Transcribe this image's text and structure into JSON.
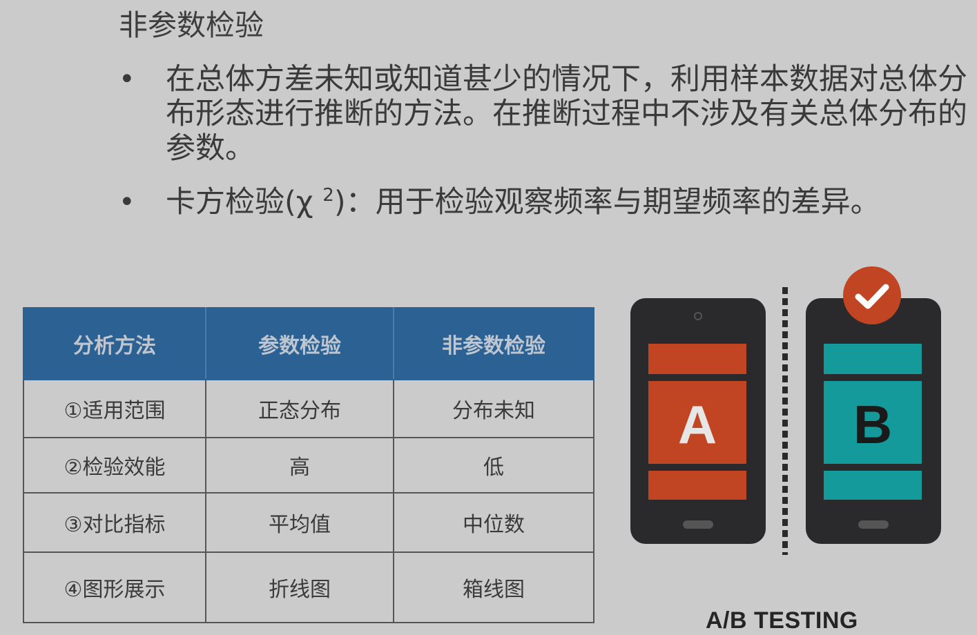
{
  "title": "非参数检验",
  "bullets": [
    {
      "marker": "•",
      "text": "在总体方差未知或知道甚少的情况下，利用样本数据对总体分布形态进行推断的方法。在推断过程中不涉及有关总体分布的参数。"
    },
    {
      "marker": "•",
      "text_before": "卡方检验(χ ",
      "sup": "2",
      "text_after": ")：用于检验观察频率与期望频率的差异。"
    }
  ],
  "table": {
    "headers": [
      "分析方法",
      "参数检验",
      "非参数检验"
    ],
    "rows": [
      [
        "①适用范围",
        "正态分布",
        "分布未知"
      ],
      [
        "②检验效能",
        "高",
        "低"
      ],
      [
        "③对比指标",
        "平均值",
        "中位数"
      ],
      [
        "④图形展示",
        "折线图",
        "箱线图"
      ]
    ]
  },
  "ab_testing": {
    "label": "A/B TESTING",
    "variant_a": "A",
    "variant_b": "B",
    "colors": {
      "phone_body": "#2a2a2c",
      "variant_a": "#c14523",
      "variant_b": "#159a9b",
      "check_badge": "#c14523",
      "check_mark": "#ffffff",
      "divider": "#2a2a2c"
    },
    "icons": [
      "phone-icon",
      "checkmark-icon"
    ]
  },
  "colors": {
    "background": "#cbcbcb",
    "header_bg": "#2b6193",
    "header_text": "#bfc6cf",
    "body_text": "#3a3a3a"
  }
}
